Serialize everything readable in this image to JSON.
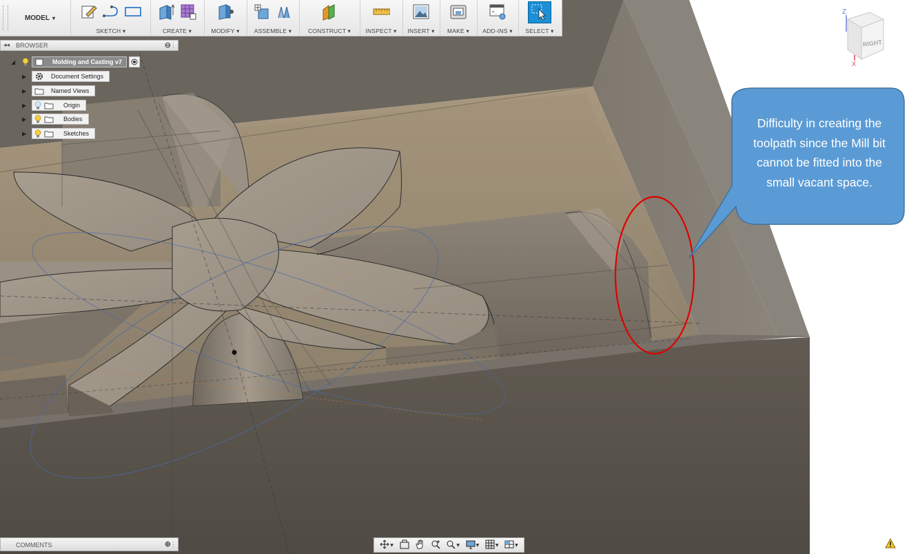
{
  "toolbar": {
    "workspace_label": "MODEL",
    "groups": [
      {
        "label": "SKETCH"
      },
      {
        "label": "CREATE"
      },
      {
        "label": "MODIFY"
      },
      {
        "label": "ASSEMBLE"
      },
      {
        "label": "CONSTRUCT"
      },
      {
        "label": "INSPECT"
      },
      {
        "label": "INSERT"
      },
      {
        "label": "MAKE"
      },
      {
        "label": "ADD-INS"
      },
      {
        "label": "SELECT"
      }
    ],
    "caret": "▾"
  },
  "browser": {
    "title": "BROWSER",
    "root": {
      "label": "Molding and Casting v7"
    },
    "nodes": [
      {
        "label": "Document Settings",
        "icon": "gear-icon"
      },
      {
        "label": "Named Views",
        "icon": "folder-icon"
      },
      {
        "label": "Origin",
        "icon": "folder-icon",
        "visibility": "off"
      },
      {
        "label": "Bodies",
        "icon": "folder-icon",
        "visibility": "on"
      },
      {
        "label": "Sketches",
        "icon": "folder-icon",
        "visibility": "on"
      }
    ]
  },
  "annotation": {
    "text": "Difficulty in creating the toolpath since the Mill bit cannot be fitted into the small vacant space.",
    "bubble_color": "#5b9bd5",
    "circle_color": "#e00000"
  },
  "comments": {
    "title": "COMMENTS"
  },
  "viewcube": {
    "face": "RIGHT",
    "axis_z": "Z",
    "axis_x": "X"
  },
  "colors": {
    "model_wall": "#5c564e",
    "floor": "#8e806e",
    "accent_select": "#1c8fd6"
  }
}
